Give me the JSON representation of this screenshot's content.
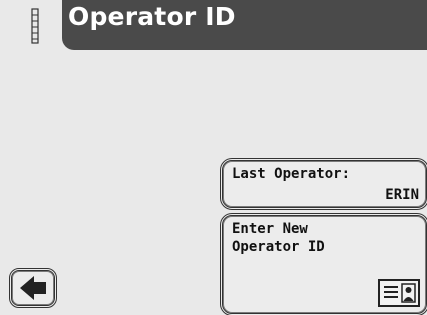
{
  "header": {
    "title": "Operator ID",
    "battery_icon": "battery-icon"
  },
  "last_operator": {
    "label": "Last Operator:",
    "value": "ERIN"
  },
  "enter_new": {
    "label": "Enter New\nOperator ID",
    "icon": "id-card-icon"
  },
  "nav": {
    "back_icon": "back-arrow-icon"
  },
  "colors": {
    "header_bg": "#4a4a4a",
    "screen_bg": "#e9e9e9",
    "border": "#333333"
  }
}
